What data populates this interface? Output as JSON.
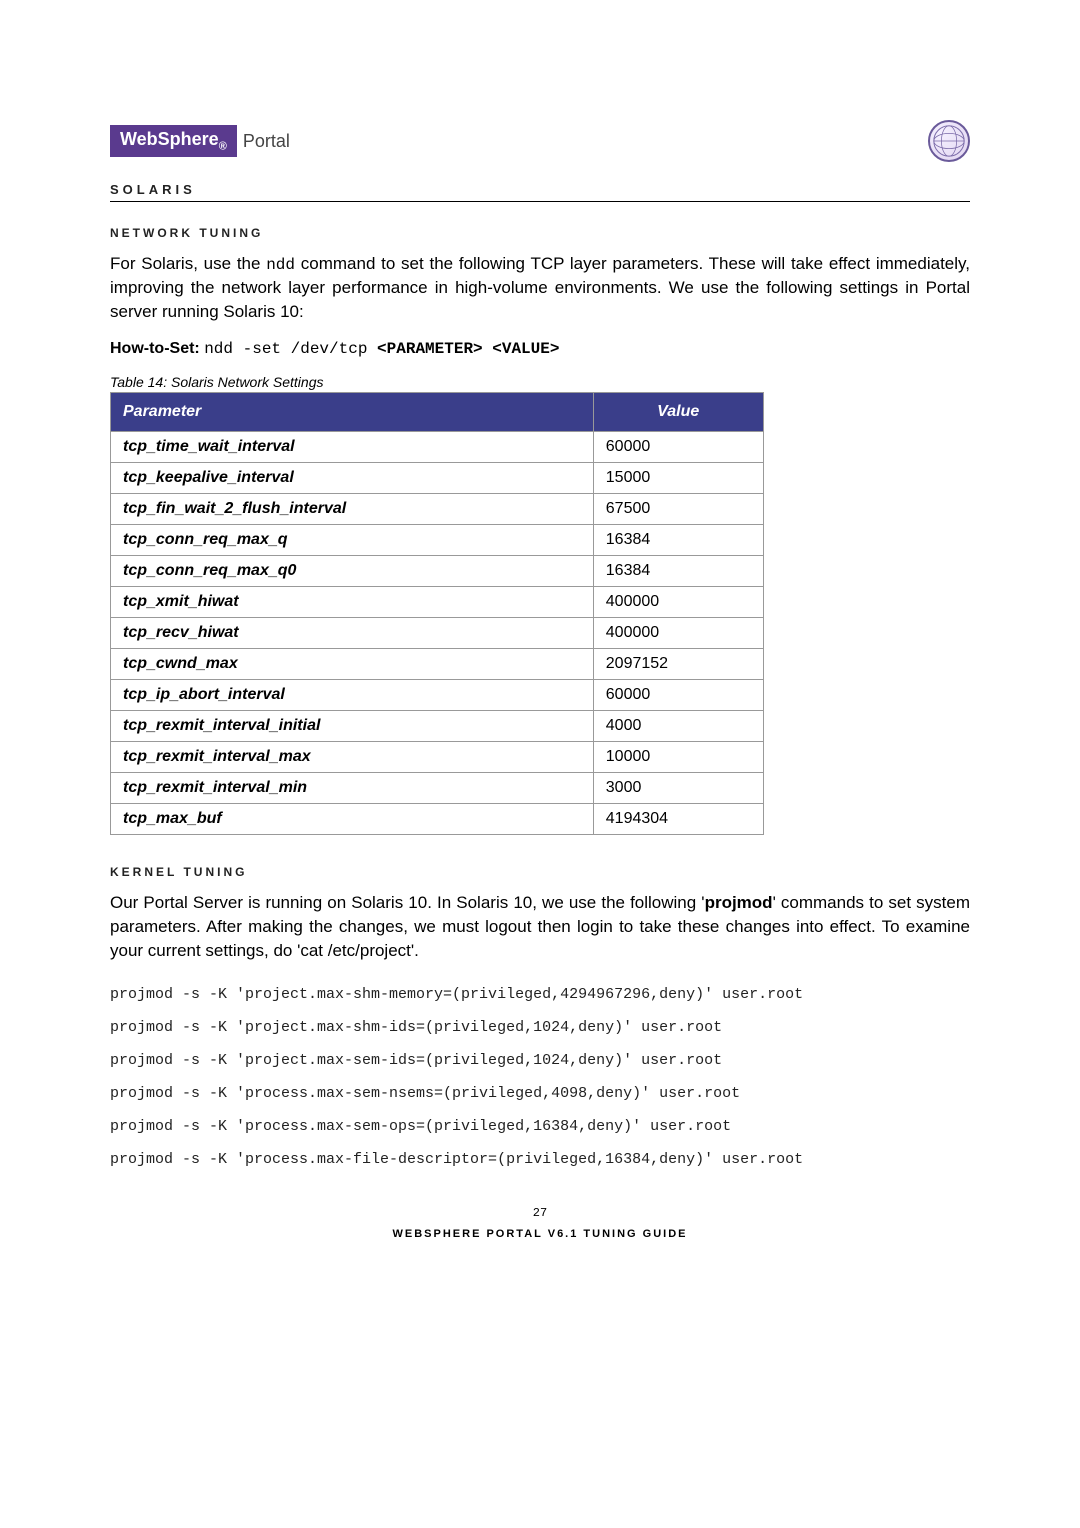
{
  "logo": {
    "brand": "WebSphere",
    "sub": "®",
    "suffix": "Portal"
  },
  "section": "SOLARIS",
  "network": {
    "heading": "NETWORK TUNING",
    "para": "For Solaris, use the ndd command to set the following TCP layer parameters.  These will take effect immediately, improving the network layer performance in high-volume environments. We use the following settings in Portal server running Solaris 10:",
    "para_pre": "For Solaris, use the ",
    "para_mono": "ndd",
    "para_post": " command to set the following TCP layer parameters.  These will take effect immediately, improving the network layer performance in high-volume environments. We use the following settings in Portal server running Solaris 10:",
    "howto_label": "How-to-Set: ",
    "howto_cmd": "ndd -set /dev/tcp ",
    "howto_bold": "<PARAMETER> <VALUE>",
    "caption": "Table 14: Solaris Network Settings",
    "th_param": "Parameter",
    "th_value": "Value",
    "rows": [
      {
        "p": "tcp_time_wait_interval",
        "v": "60000"
      },
      {
        "p": "tcp_keepalive_interval",
        "v": "15000"
      },
      {
        "p": "tcp_fin_wait_2_flush_interval",
        "v": "67500"
      },
      {
        "p": "tcp_conn_req_max_q",
        "v": "16384"
      },
      {
        "p": "tcp_conn_req_max_q0",
        "v": "16384"
      },
      {
        "p": "tcp_xmit_hiwat",
        "v": "400000"
      },
      {
        "p": "tcp_recv_hiwat",
        "v": "400000"
      },
      {
        "p": "tcp_cwnd_max",
        "v": "2097152"
      },
      {
        "p": "tcp_ip_abort_interval",
        "v": "60000"
      },
      {
        "p": "tcp_rexmit_interval_initial",
        "v": "4000"
      },
      {
        "p": "tcp_rexmit_interval_max",
        "v": "10000"
      },
      {
        "p": "tcp_rexmit_interval_min",
        "v": "3000"
      },
      {
        "p": "tcp_max_buf",
        "v": "4194304"
      }
    ]
  },
  "kernel": {
    "heading": "KERNEL TUNING",
    "para_pre": "Our Portal Server is running on Solaris 10. In Solaris 10, we use the following '",
    "para_bold": "projmod",
    "para_post": "' commands to set system parameters. After making the changes, we must logout then login to take these changes into effect. To examine your current settings, do 'cat /etc/project'.",
    "cmds": [
      "projmod -s -K 'project.max-shm-memory=(privileged,4294967296,deny)' user.root",
      "projmod -s -K 'project.max-shm-ids=(privileged,1024,deny)' user.root",
      "projmod -s -K 'project.max-sem-ids=(privileged,1024,deny)' user.root",
      "projmod -s -K 'process.max-sem-nsems=(privileged,4098,deny)' user.root",
      "projmod -s -K 'process.max-sem-ops=(privileged,16384,deny)' user.root",
      "projmod -s -K 'process.max-file-descriptor=(privileged,16384,deny)' user.root"
    ]
  },
  "footer": {
    "page": "27",
    "title": "WEBSPHERE PORTAL V6.1 TUNING GUIDE"
  }
}
